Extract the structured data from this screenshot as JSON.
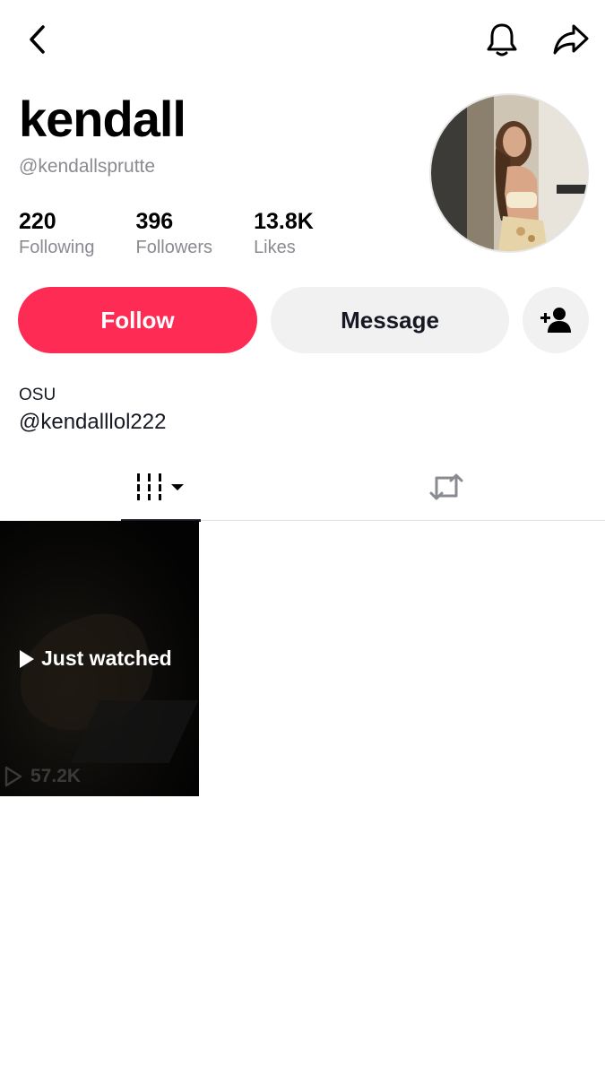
{
  "profile": {
    "display_name": "kendall",
    "username": "@kendallsprutte"
  },
  "stats": [
    {
      "value": "220",
      "label": "Following"
    },
    {
      "value": "396",
      "label": "Followers"
    },
    {
      "value": "13.8K",
      "label": "Likes"
    }
  ],
  "actions": {
    "follow_label": "Follow",
    "message_label": "Message"
  },
  "bio": {
    "line1": "OSU",
    "line2": "@kendalllol222"
  },
  "videos": [
    {
      "overlay_label": "Just watched",
      "views": "57.2K"
    }
  ],
  "colors": {
    "follow_button": "#fe2c55",
    "secondary_button": "#f1f1f2",
    "muted_text": "#8a8b91"
  }
}
